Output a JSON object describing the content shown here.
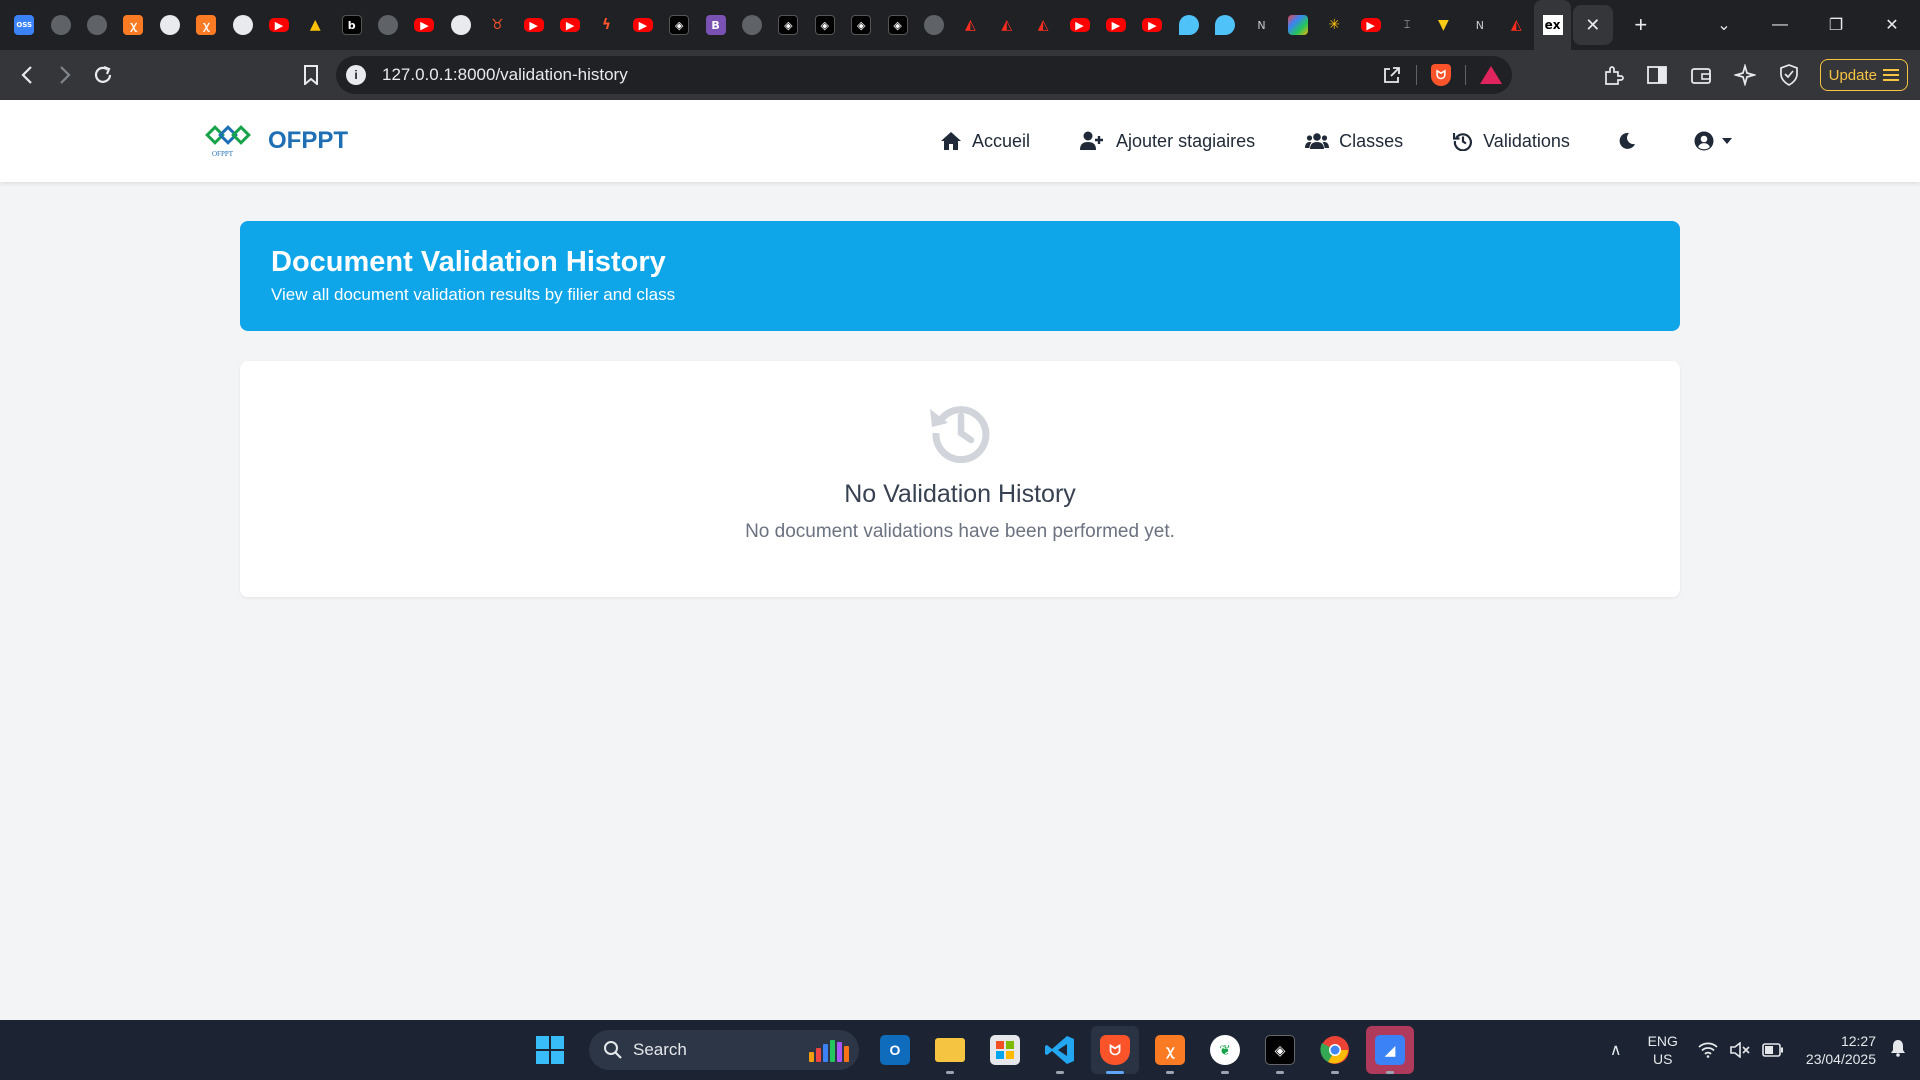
{
  "browser": {
    "tab_favicons": [
      {
        "icon": "oss-icon",
        "glyph": "OSS",
        "style": "g-oss"
      },
      {
        "icon": "globe-icon",
        "glyph": "",
        "style": "g-globe"
      },
      {
        "icon": "shield-icon",
        "glyph": "",
        "style": "g-globe"
      },
      {
        "icon": "xampp-icon",
        "glyph": "ꭓ",
        "style": "g-xampp"
      },
      {
        "icon": "github-icon",
        "glyph": "",
        "style": "g-gh"
      },
      {
        "icon": "xampp-icon",
        "glyph": "ꭓ",
        "style": "g-xampp"
      },
      {
        "icon": "github-icon",
        "glyph": "",
        "style": "g-gh"
      },
      {
        "icon": "youtube-icon",
        "glyph": "▶",
        "style": "g-yt"
      },
      {
        "icon": "pyramid-icon",
        "glyph": "▲",
        "style": "g-pluto"
      },
      {
        "icon": "b-icon",
        "glyph": "b",
        "style": "g-dark"
      },
      {
        "icon": "globe-icon",
        "glyph": "",
        "style": "g-globe"
      },
      {
        "icon": "youtube-icon",
        "glyph": "▶",
        "style": "g-yt"
      },
      {
        "icon": "github-icon",
        "glyph": "",
        "style": "g-gh"
      },
      {
        "icon": "bull-icon",
        "glyph": "♉",
        "style": "g-brave"
      },
      {
        "icon": "youtube-icon",
        "glyph": "▶",
        "style": "g-yt"
      },
      {
        "icon": "youtube-icon",
        "glyph": "▶",
        "style": "g-yt"
      },
      {
        "icon": "bolt-icon",
        "glyph": "ϟ",
        "style": "g-brave"
      },
      {
        "icon": "youtube-icon",
        "glyph": "▶",
        "style": "g-yt"
      },
      {
        "icon": "cube-icon",
        "glyph": "◈",
        "style": "g-dark"
      },
      {
        "icon": "bootstrap-icon",
        "glyph": "B",
        "style": "g-b"
      },
      {
        "icon": "globe-icon",
        "glyph": "",
        "style": "g-globe"
      },
      {
        "icon": "cube-icon",
        "glyph": "◈",
        "style": "g-dark"
      },
      {
        "icon": "cube-icon",
        "glyph": "◈",
        "style": "g-dark"
      },
      {
        "icon": "cube-icon",
        "glyph": "◈",
        "style": "g-dark"
      },
      {
        "icon": "cube-icon",
        "glyph": "◈",
        "style": "g-dark"
      },
      {
        "icon": "globe-icon",
        "glyph": "",
        "style": "g-globe"
      },
      {
        "icon": "laravel-icon",
        "glyph": "◭",
        "style": "g-laravel"
      },
      {
        "icon": "laravel-icon",
        "glyph": "◭",
        "style": "g-laravel"
      },
      {
        "icon": "laravel-icon",
        "glyph": "◭",
        "style": "g-laravel"
      },
      {
        "icon": "youtube-icon",
        "glyph": "▶",
        "style": "g-yt"
      },
      {
        "icon": "youtube-icon",
        "glyph": "▶",
        "style": "g-yt"
      },
      {
        "icon": "youtube-icon",
        "glyph": "▶",
        "style": "g-yt"
      },
      {
        "icon": "location-icon",
        "glyph": "",
        "style": "g-shield"
      },
      {
        "icon": "location-icon",
        "glyph": "",
        "style": "g-shield"
      },
      {
        "icon": "n-icon",
        "glyph": "N",
        "style": "g-thin"
      },
      {
        "icon": "copilot-icon",
        "glyph": "",
        "style": "g-multi"
      },
      {
        "icon": "openai-icon",
        "glyph": "✳",
        "style": "g-pluto"
      },
      {
        "icon": "youtube-icon",
        "glyph": "▶",
        "style": "g-yt"
      },
      {
        "icon": "text-cursor-icon",
        "glyph": "⌶",
        "style": "g-thin"
      },
      {
        "icon": "vite-icon",
        "glyph": "▼",
        "style": "g-tri"
      },
      {
        "icon": "n-icon",
        "glyph": "N",
        "style": "g-thin"
      },
      {
        "icon": "laravel-icon",
        "glyph": "◭",
        "style": "g-laravel"
      },
      {
        "icon": "ex-icon",
        "glyph": "ex",
        "style": "g-ex"
      }
    ],
    "url": "127.0.0.1:8000/validation-history",
    "update_label": "Update"
  },
  "site": {
    "logo_text": "OFPPT",
    "brand": "OFPPT",
    "nav": {
      "home": "Accueil",
      "add_trainees": "Ajouter stagiaires",
      "classes": "Classes",
      "validations": "Validations"
    }
  },
  "page": {
    "title": "Document Validation History",
    "subtitle": "View all document validation results by filier and class",
    "empty_title": "No Validation History",
    "empty_message": "No document validations have been performed yet."
  },
  "taskbar": {
    "search_label": "Search",
    "lang_line1": "ENG",
    "lang_line2": "US",
    "time": "12:27",
    "date": "23/04/2025"
  },
  "colors": {
    "brand": "#1f6fb5",
    "hero": "#0ea5e9",
    "page_bg": "#f3f4f6"
  }
}
